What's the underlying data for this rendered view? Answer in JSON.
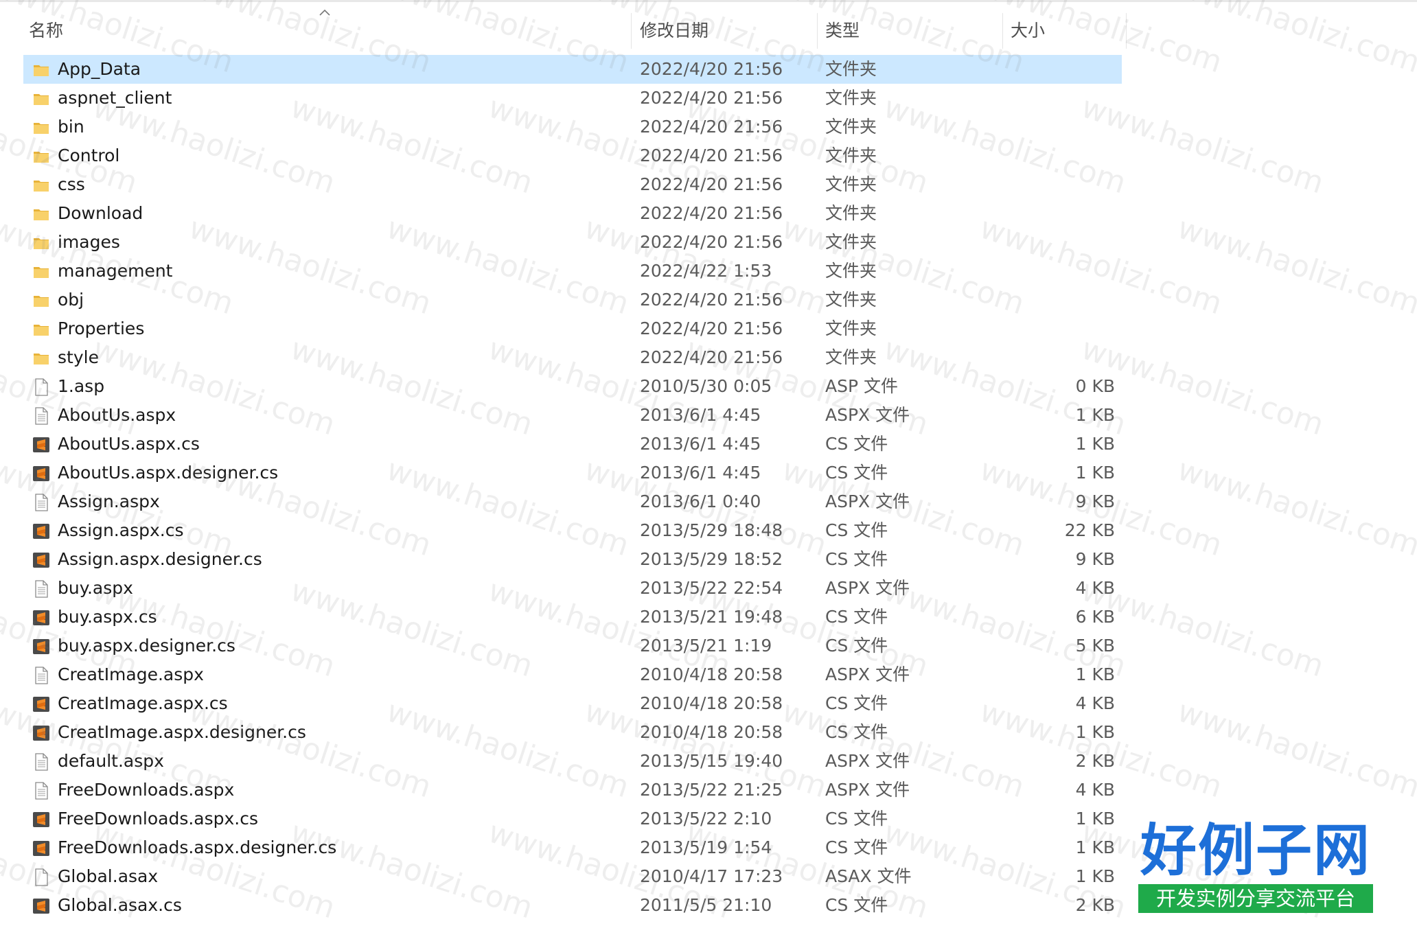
{
  "columns": {
    "name": "名称",
    "date": "修改日期",
    "type": "类型",
    "size": "大小"
  },
  "files": [
    {
      "name": "App_Data",
      "date": "2022/4/20 21:56",
      "type": "文件夹",
      "size": "",
      "icon": "folder-icon",
      "selected": true
    },
    {
      "name": "aspnet_client",
      "date": "2022/4/20 21:56",
      "type": "文件夹",
      "size": "",
      "icon": "folder-icon"
    },
    {
      "name": "bin",
      "date": "2022/4/20 21:56",
      "type": "文件夹",
      "size": "",
      "icon": "folder-icon"
    },
    {
      "name": "Control",
      "date": "2022/4/20 21:56",
      "type": "文件夹",
      "size": "",
      "icon": "folder-icon"
    },
    {
      "name": "css",
      "date": "2022/4/20 21:56",
      "type": "文件夹",
      "size": "",
      "icon": "folder-icon"
    },
    {
      "name": "Download",
      "date": "2022/4/20 21:56",
      "type": "文件夹",
      "size": "",
      "icon": "folder-icon"
    },
    {
      "name": "images",
      "date": "2022/4/20 21:56",
      "type": "文件夹",
      "size": "",
      "icon": "folder-icon"
    },
    {
      "name": "management",
      "date": "2022/4/22 1:53",
      "type": "文件夹",
      "size": "",
      "icon": "folder-icon"
    },
    {
      "name": "obj",
      "date": "2022/4/20 21:56",
      "type": "文件夹",
      "size": "",
      "icon": "folder-icon"
    },
    {
      "name": "Properties",
      "date": "2022/4/20 21:56",
      "type": "文件夹",
      "size": "",
      "icon": "folder-icon"
    },
    {
      "name": "style",
      "date": "2022/4/20 21:56",
      "type": "文件夹",
      "size": "",
      "icon": "folder-icon"
    },
    {
      "name": "1.asp",
      "date": "2010/5/30 0:05",
      "type": "ASP 文件",
      "size": "0 KB",
      "icon": "blank-file-icon"
    },
    {
      "name": "AboutUs.aspx",
      "date": "2013/6/1 4:45",
      "type": "ASPX 文件",
      "size": "1 KB",
      "icon": "document-file-icon"
    },
    {
      "name": "AboutUs.aspx.cs",
      "date": "2013/6/1 4:45",
      "type": "CS 文件",
      "size": "1 KB",
      "icon": "sublime-file-icon"
    },
    {
      "name": "AboutUs.aspx.designer.cs",
      "date": "2013/6/1 4:45",
      "type": "CS 文件",
      "size": "1 KB",
      "icon": "sublime-file-icon"
    },
    {
      "name": "Assign.aspx",
      "date": "2013/6/1 0:40",
      "type": "ASPX 文件",
      "size": "9 KB",
      "icon": "document-file-icon"
    },
    {
      "name": "Assign.aspx.cs",
      "date": "2013/5/29 18:48",
      "type": "CS 文件",
      "size": "22 KB",
      "icon": "sublime-file-icon"
    },
    {
      "name": "Assign.aspx.designer.cs",
      "date": "2013/5/29 18:52",
      "type": "CS 文件",
      "size": "9 KB",
      "icon": "sublime-file-icon"
    },
    {
      "name": "buy.aspx",
      "date": "2013/5/22 22:54",
      "type": "ASPX 文件",
      "size": "4 KB",
      "icon": "document-file-icon"
    },
    {
      "name": "buy.aspx.cs",
      "date": "2013/5/21 19:48",
      "type": "CS 文件",
      "size": "6 KB",
      "icon": "sublime-file-icon"
    },
    {
      "name": "buy.aspx.designer.cs",
      "date": "2013/5/21 1:19",
      "type": "CS 文件",
      "size": "5 KB",
      "icon": "sublime-file-icon"
    },
    {
      "name": "CreatImage.aspx",
      "date": "2010/4/18 20:58",
      "type": "ASPX 文件",
      "size": "1 KB",
      "icon": "document-file-icon"
    },
    {
      "name": "CreatImage.aspx.cs",
      "date": "2010/4/18 20:58",
      "type": "CS 文件",
      "size": "4 KB",
      "icon": "sublime-file-icon"
    },
    {
      "name": "CreatImage.aspx.designer.cs",
      "date": "2010/4/18 20:58",
      "type": "CS 文件",
      "size": "1 KB",
      "icon": "sublime-file-icon"
    },
    {
      "name": "default.aspx",
      "date": "2013/5/15 19:40",
      "type": "ASPX 文件",
      "size": "2 KB",
      "icon": "document-file-icon"
    },
    {
      "name": "FreeDownloads.aspx",
      "date": "2013/5/22 21:25",
      "type": "ASPX 文件",
      "size": "4 KB",
      "icon": "document-file-icon"
    },
    {
      "name": "FreeDownloads.aspx.cs",
      "date": "2013/5/22 2:10",
      "type": "CS 文件",
      "size": "1 KB",
      "icon": "sublime-file-icon"
    },
    {
      "name": "FreeDownloads.aspx.designer.cs",
      "date": "2013/5/19 1:54",
      "type": "CS 文件",
      "size": "1 KB",
      "icon": "sublime-file-icon"
    },
    {
      "name": "Global.asax",
      "date": "2010/4/17 17:23",
      "type": "ASAX 文件",
      "size": "1 KB",
      "icon": "blank-file-icon"
    },
    {
      "name": "Global.asax.cs",
      "date": "2011/5/5 21:10",
      "type": "CS 文件",
      "size": "2 KB",
      "icon": "sublime-file-icon"
    }
  ],
  "watermark": {
    "text": "www.haolizi.com"
  },
  "logo": {
    "main": "好例子网",
    "sub": "开发实例分享交流平台"
  },
  "colors": {
    "selection": "#cce8ff",
    "folder": "#f4c542",
    "sublime_orange": "#f28c28",
    "logo_blue": "#1d6fd8",
    "logo_green": "#1faa4a"
  }
}
